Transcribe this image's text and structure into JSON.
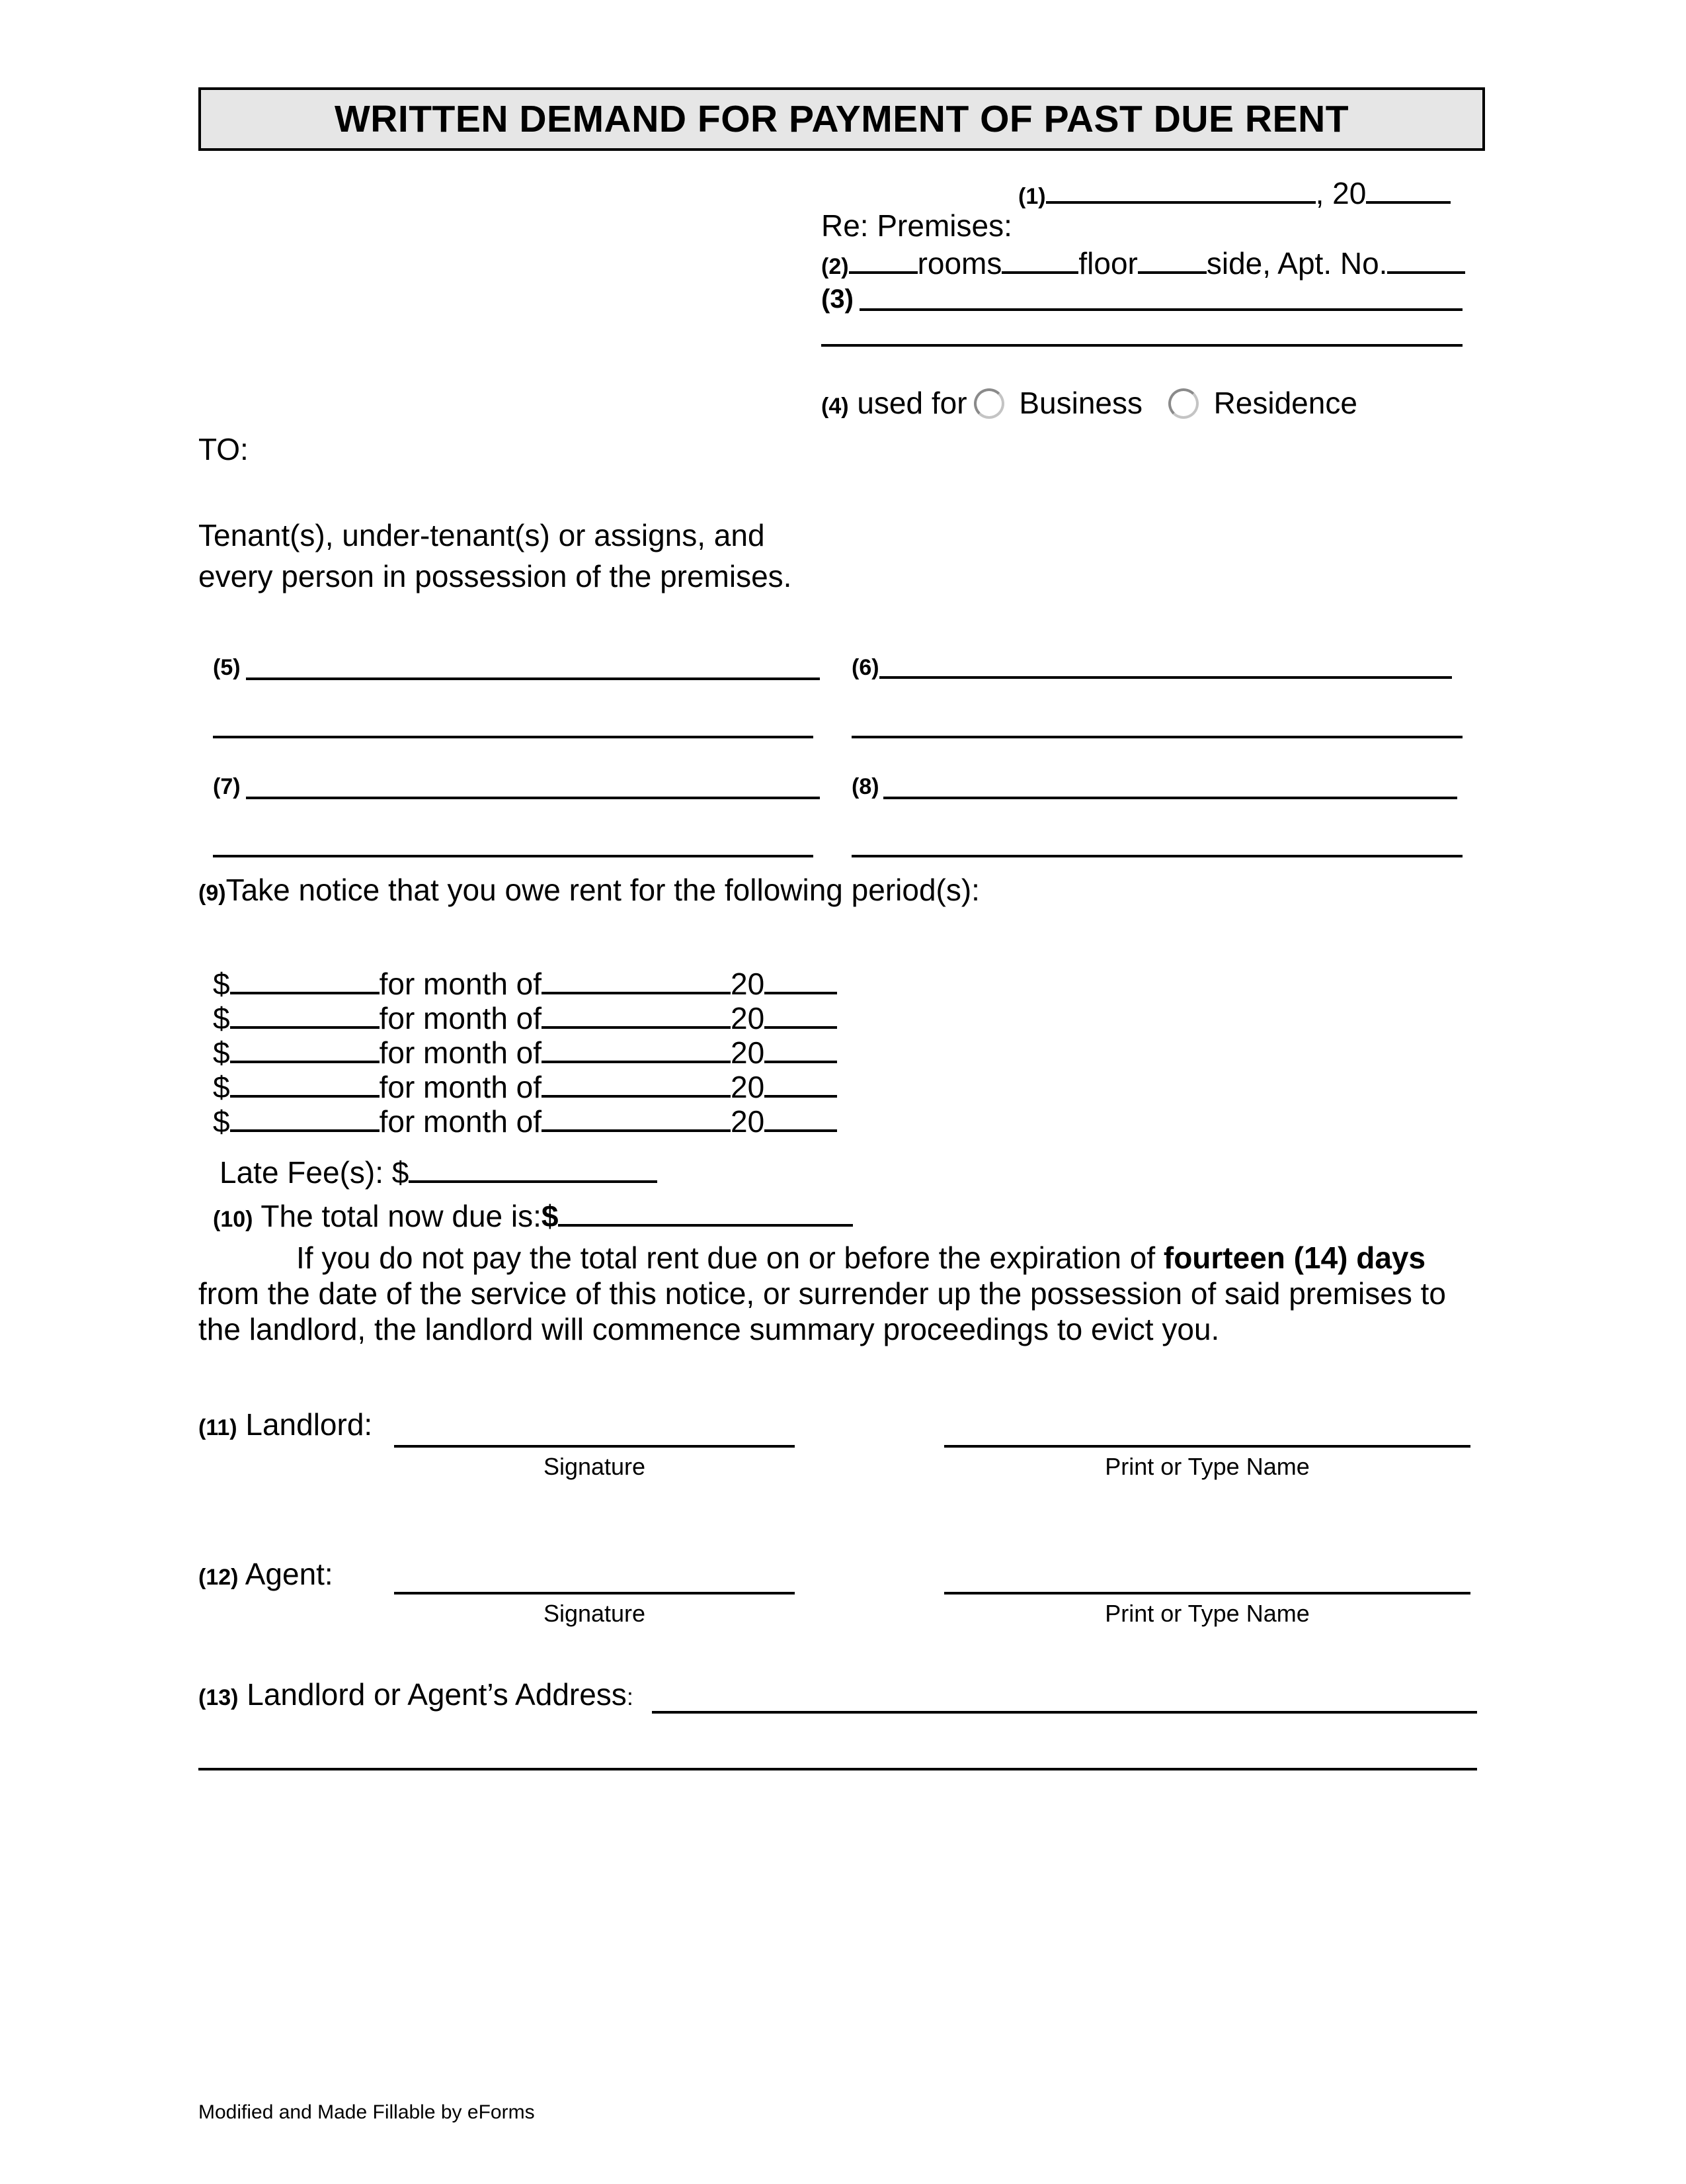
{
  "document": {
    "title": "WRITTEN DEMAND FOR PAYMENT OF PAST DUE RENT",
    "header": {
      "field1_num": "(1)",
      "year_prefix": ", 20",
      "re_premises": "Re: Premises:",
      "field2_num": "(2)",
      "rooms_label": "rooms",
      "floor_label": "floor",
      "side_label": "side, Apt. No.",
      "field3_num": "(3)",
      "field4_num": "(4)",
      "used_for_label": "used for",
      "options": [
        {
          "label": "Business",
          "selected": false
        },
        {
          "label": "Residence",
          "selected": false
        }
      ]
    },
    "to_label": "TO:",
    "recipients_line1": "Tenant(s), under-tenant(s) or assigns, and",
    "recipients_line2": "every person in possession of the premises.",
    "address_fields": {
      "f5": "(5)",
      "f6": "(6)",
      "f7": "(7)",
      "f8": "(8)"
    },
    "notice": {
      "num": "(9)",
      "text": "Take notice that you owe rent for the following period(s):"
    },
    "rent_rows": [
      {
        "currency": "$",
        "for_month": "for month of",
        "year_prefix": "20"
      },
      {
        "currency": "$",
        "for_month": "for month of",
        "year_prefix": "20"
      },
      {
        "currency": "$",
        "for_month": "for month of",
        "year_prefix": "20"
      },
      {
        "currency": "$",
        "for_month": "for month of",
        "year_prefix": "20"
      },
      {
        "currency": "$",
        "for_month": "for month of",
        "year_prefix": "20"
      }
    ],
    "late_fee_label": "Late Fee(s): $",
    "total": {
      "num": "(10)",
      "label": "The total now due is:",
      "currency": "$"
    },
    "warning": {
      "part1": "If you do not pay the total rent due on or before the expiration of ",
      "bold": "fourteen (14) days",
      "part2": "from the date of the service of this notice, or surrender up the possession of said premises to",
      "part3": "the landlord, the landlord will commence summary proceedings to evict you."
    },
    "landlord": {
      "num": "(11)",
      "label": "Landlord:",
      "signature_caption": "Signature",
      "name_caption": "Print or Type Name"
    },
    "agent": {
      "num": "(12)",
      "label": "Agent:",
      "signature_caption": "Signature",
      "name_caption": "Print or Type Name"
    },
    "address": {
      "num": "(13)",
      "label": "Landlord or Agent’s Address",
      "colon": ":"
    },
    "footer": "Modified and Made Fillable by eForms"
  }
}
